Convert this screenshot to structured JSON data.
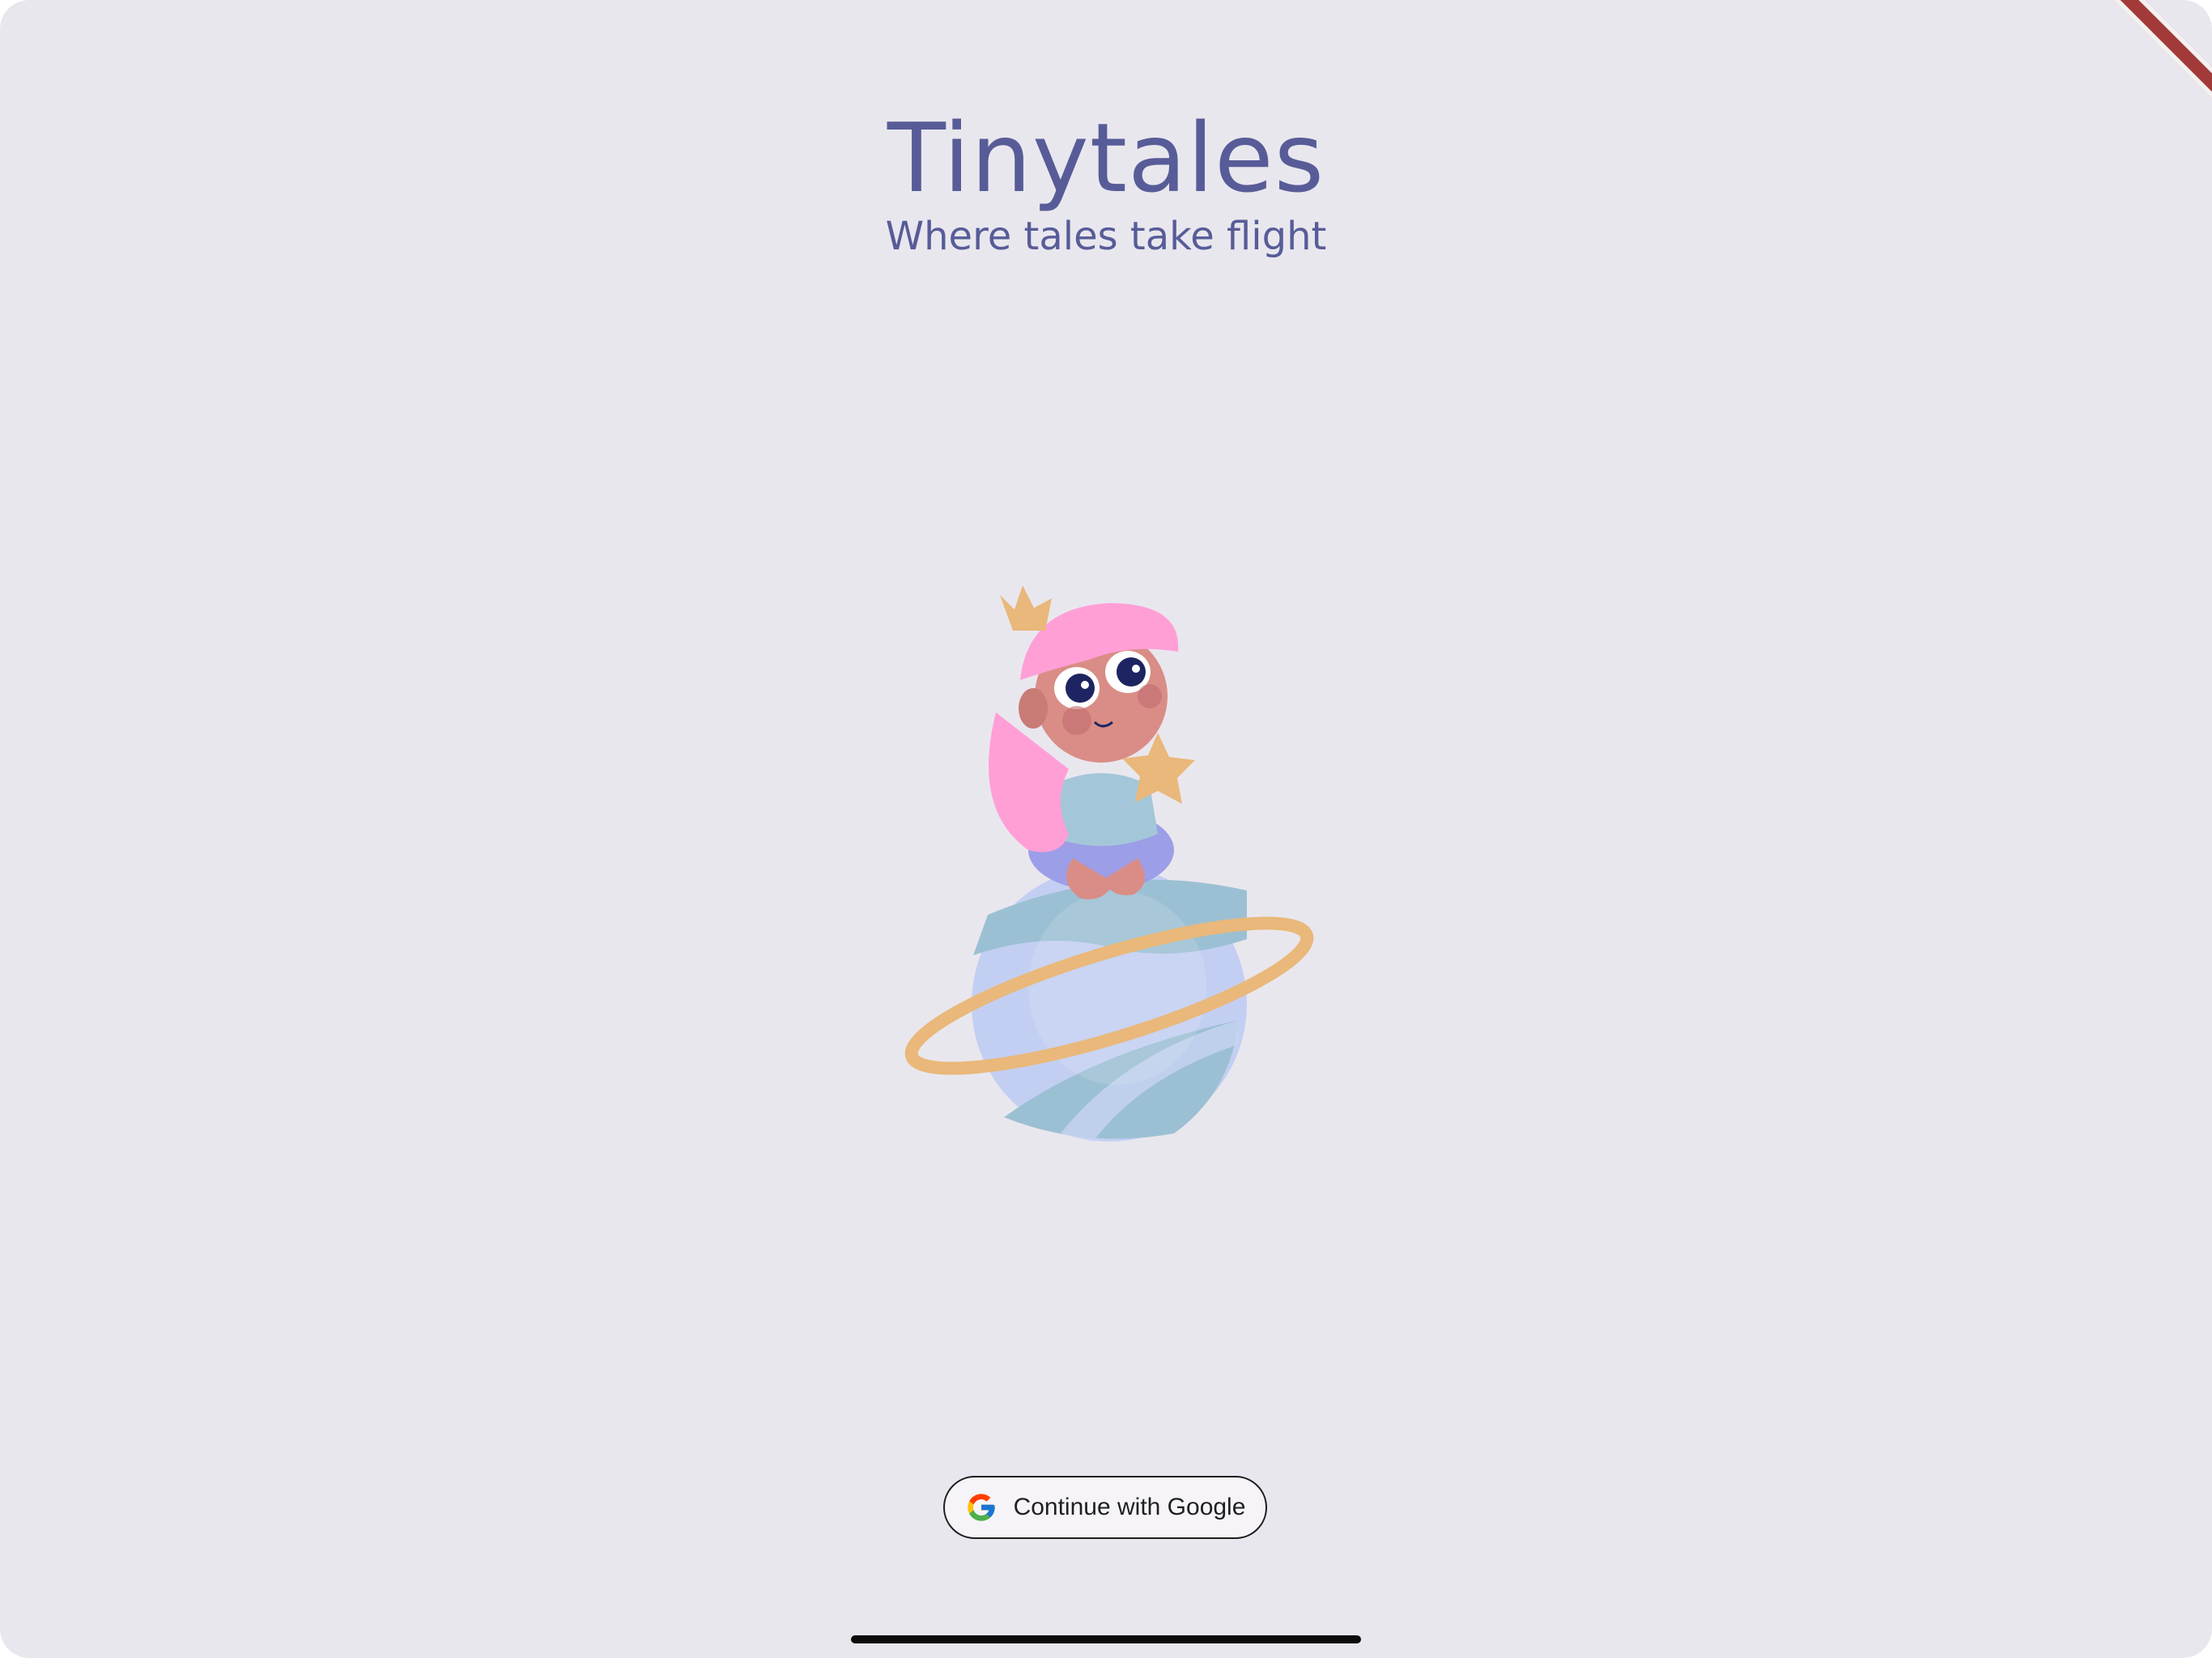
{
  "app": {
    "title": "Tinytales",
    "tagline": "Where tales take flight"
  },
  "illustration": {
    "subject": "girl-sitting-on-planet-holding-star"
  },
  "auth": {
    "google_button_label": "Continue with Google",
    "google_icon": "google-g-icon"
  },
  "colors": {
    "background": "#e9e7ee",
    "title": "#575c98",
    "button_border": "#1d1d1d",
    "button_bg": "#f6f4f9"
  }
}
